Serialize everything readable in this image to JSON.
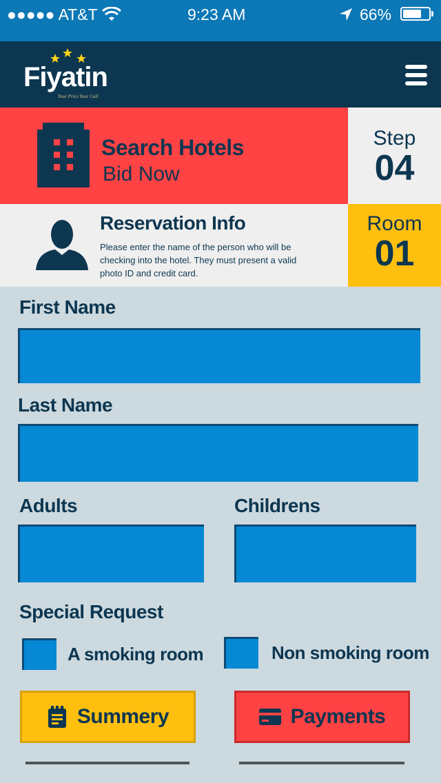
{
  "status_bar": {
    "carrier": "●●●●● AT&T",
    "time": "9:23 AM",
    "battery": "66%"
  },
  "header": {
    "logo_text": "Fiyatin",
    "logo_tagline": "Your Price Your Call",
    "menu_icon": "hamburger-icon"
  },
  "step_banner": {
    "title": "Search Hotels",
    "subtitle": "Bid Now",
    "step_label": "Step",
    "step_number": "04",
    "icon": "building-icon"
  },
  "reservation": {
    "title": "Reservation Info",
    "description": "Please enter the name of the person who will be checking into the hotel. They must present a valid photo ID and credit card.",
    "room_label": "Room",
    "room_number": "01",
    "icon": "person-icon"
  },
  "form": {
    "first_name_label": "First  Name",
    "last_name_label": "Last Name",
    "adults_label": "Adults",
    "childrens_label": "Childrens",
    "special_request_label": "Special Request",
    "smoking_label": "A smoking room",
    "non_smoking_label": "Non smoking room"
  },
  "buttons": {
    "summary_label": "Summery",
    "payments_label": "Payments"
  },
  "colors": {
    "status_bar": "#0c78b6",
    "header": "#0d3650",
    "red": "#ff4244",
    "yellow": "#ffbf0f",
    "field": "#0788d4",
    "background": "#ccd9df"
  }
}
